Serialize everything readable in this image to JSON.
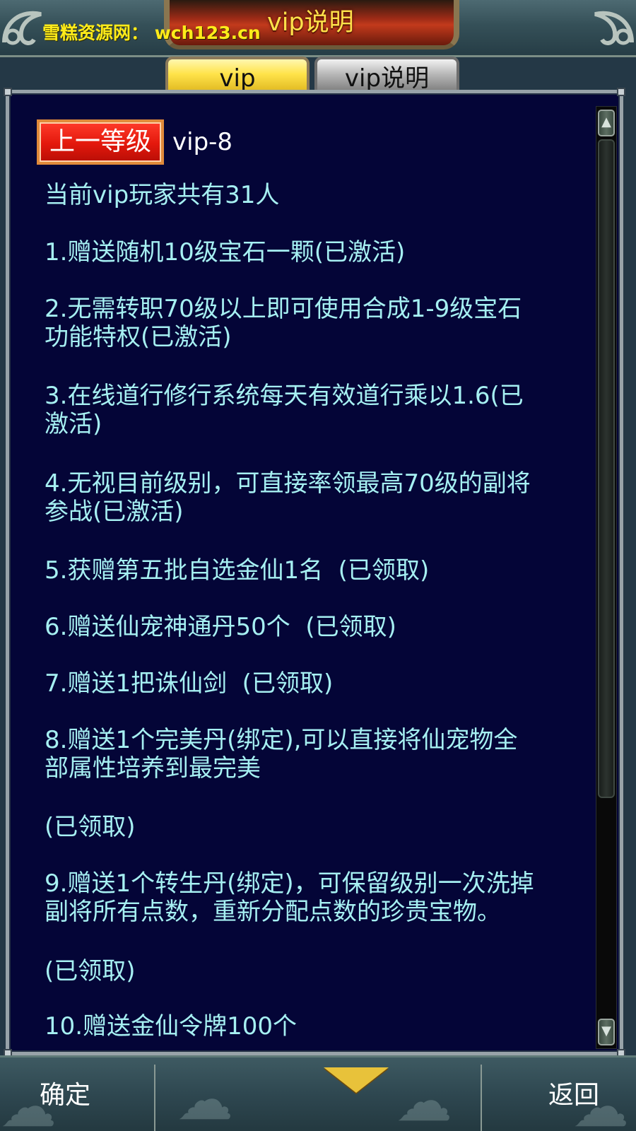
{
  "header": {
    "title": "vip说明",
    "watermark": "雪糕资源网：  wch123.cn"
  },
  "tabs": [
    {
      "label": "vip",
      "active": true
    },
    {
      "label": "vip说明",
      "active": false
    }
  ],
  "content": {
    "prev_level_button": "上一等级",
    "level_label": "vip-8",
    "lines": [
      "当前vip玩家共有31人",
      "1.赠送随机10级宝石一颗(已激活)",
      "2.无需转职70级以上即可使用合成1-9级宝石",
      "功能特权(已激活)",
      "3.在线道行修行系统每天有效道行乘以1.6(已",
      "激活)",
      "4.无视目前级别，可直接率领最高70级的副将",
      "参战(已激活)",
      "5.获赠第五批自选金仙1名  (已领取)",
      "6.赠送仙宠神通丹50个  (已领取)",
      "7.赠送1把诛仙剑  (已领取)",
      "8.赠送1个完美丹(绑定),可以直接将仙宠物全",
      "部属性培养到最完美",
      "(已领取)",
      "9.赠送1个转生丹(绑定)，可保留级别一次洗掉",
      "副将所有点数，重新分配点数的珍贵宝物。",
      "(已领取)",
      "10.赠送金仙令牌100个"
    ]
  },
  "footer": {
    "confirm_label": "确定",
    "back_label": "返回"
  },
  "colors": {
    "panel_bg": "#040537",
    "text": "#a6f0f2",
    "title": "#ffe24a",
    "watermark": "#ffeb1a",
    "button_red": "#e3180c"
  },
  "icons": {
    "scroll_up": "scroll-up-arrow-icon",
    "scroll_down": "scroll-down-arrow-icon",
    "footer_center": "down-arrow-icon"
  }
}
